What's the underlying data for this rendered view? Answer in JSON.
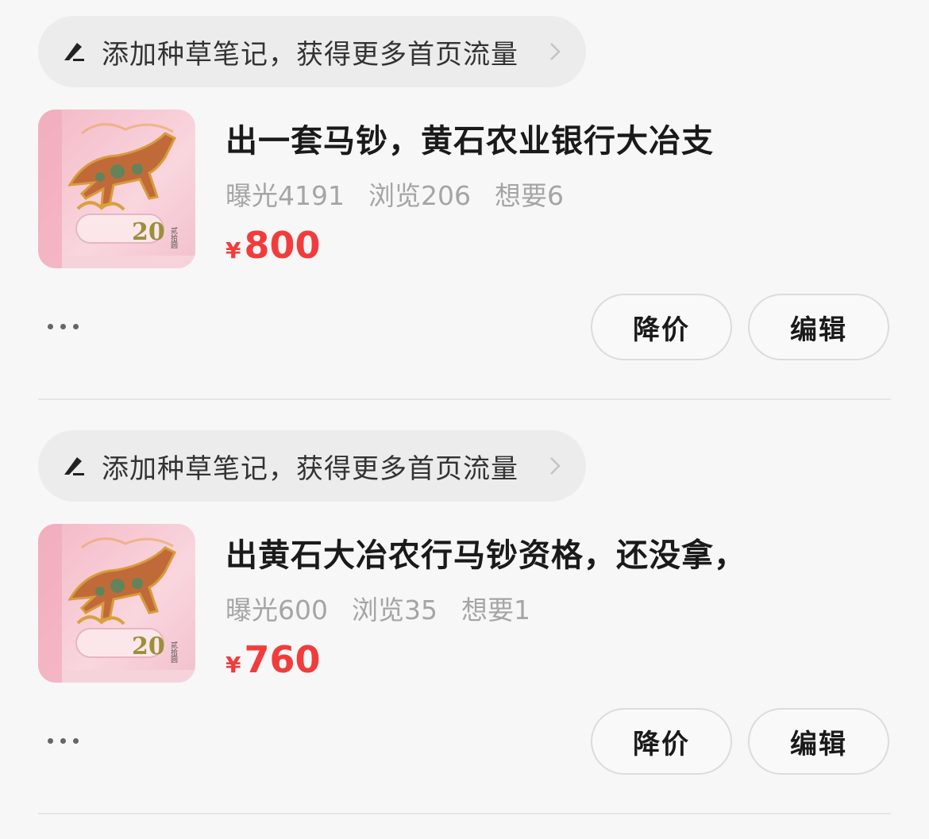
{
  "listings": [
    {
      "promo_text": "添加种草笔记，获得更多首页流量",
      "title": "出一套马钞，黄石农业银行大冶支",
      "stats": {
        "exposure": "曝光4191",
        "views": "浏览206",
        "wants": "想要6"
      },
      "currency": "¥",
      "price": "800",
      "reduce_label": "降价",
      "edit_label": "编辑"
    },
    {
      "promo_text": "添加种草笔记，获得更多首页流量",
      "title": "出黄石大冶农行马钞资格，还没拿，",
      "stats": {
        "exposure": "曝光600",
        "views": "浏览35",
        "wants": "想要1"
      },
      "currency": "¥",
      "price": "760",
      "reduce_label": "降价",
      "edit_label": "编辑"
    }
  ],
  "thumbnail": {
    "denomination": "20",
    "side_text": "贰拾圆"
  },
  "colors": {
    "price": "#f23c3c",
    "background": "#f7f7f7",
    "pill": "#ececec"
  },
  "icons": {
    "promo": "pen-icon",
    "promo_arrow": "chevron-right-icon",
    "more": "more-dots-icon"
  }
}
